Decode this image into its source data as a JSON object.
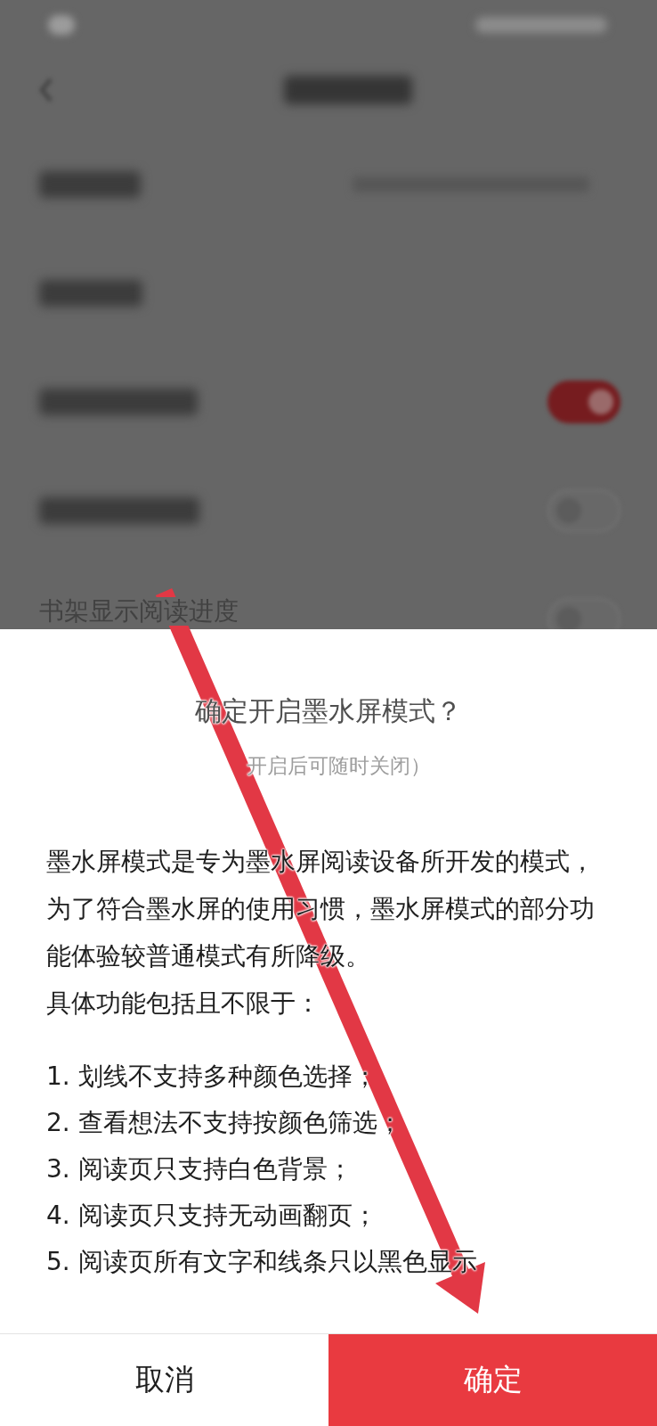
{
  "background_page": {
    "rows": [
      {
        "kind": "value"
      },
      {
        "kind": "plain"
      },
      {
        "kind": "toggle",
        "on": true
      },
      {
        "kind": "toggle",
        "on": false
      },
      {
        "kind": "toggle",
        "on": false,
        "label": "书架显示阅读进度"
      }
    ]
  },
  "dialog": {
    "title": "确定开启墨水屏模式？",
    "subtitle": "开启后可随时关闭）",
    "description": "墨水屏模式是专为墨水屏阅读设备所开发的模式，为了符合墨水屏的使用习惯，墨水屏模式的部分功能体验较普通模式有所降级。",
    "list_heading": "具体功能包括且不限于：",
    "items": [
      "1. 划线不支持多种颜色选择；",
      "2. 查看想法不支持按颜色筛选；",
      "3. 阅读页只支持白色背景；",
      "4. 阅读页只支持无动画翻页；",
      "5. 阅读页所有文字和线条只以黑色显示"
    ],
    "buttons": [
      {
        "kind": "cancel",
        "label": "取消"
      },
      {
        "kind": "confirm",
        "label": "确定"
      }
    ]
  },
  "annotation": {
    "kind": "arrow"
  }
}
